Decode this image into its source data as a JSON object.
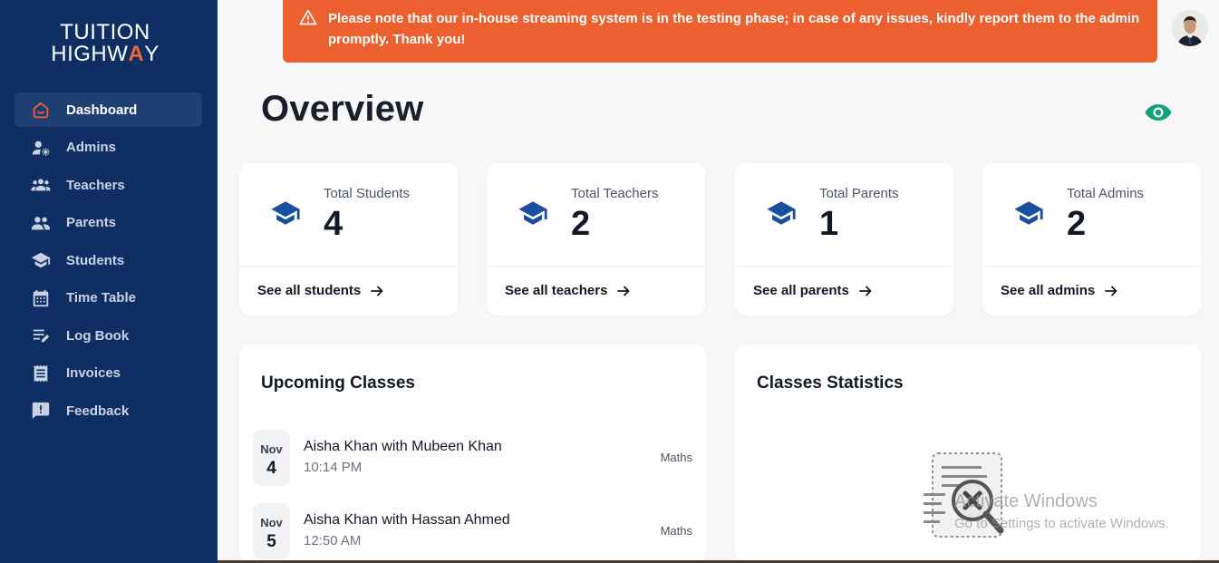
{
  "brand": {
    "line1": "TUITION",
    "line2_pre": "HIGHW",
    "line2_accent": "A",
    "line2_post": "Y"
  },
  "sidebar": {
    "items": [
      {
        "label": "Dashboard",
        "icon": "home-icon",
        "active": true
      },
      {
        "label": "Admins",
        "icon": "admin-icon"
      },
      {
        "label": "Teachers",
        "icon": "group-icon"
      },
      {
        "label": "Parents",
        "icon": "people-icon"
      },
      {
        "label": "Students",
        "icon": "graduation-cap-icon"
      },
      {
        "label": "Time Table",
        "icon": "calendar-icon"
      },
      {
        "label": "Log Book",
        "icon": "edit-list-icon"
      },
      {
        "label": "Invoices",
        "icon": "invoice-icon"
      },
      {
        "label": "Feedback",
        "icon": "feedback-icon"
      }
    ]
  },
  "banner": {
    "message": "Please note that our in-house streaming system is in the testing phase; in case of any issues, kindly report them to the admin promptly. Thank you!"
  },
  "page": {
    "title": "Overview"
  },
  "stats": [
    {
      "label": "Total Students",
      "value": "4",
      "link": "See all students"
    },
    {
      "label": "Total Teachers",
      "value": "2",
      "link": "See all teachers"
    },
    {
      "label": "Total Parents",
      "value": "1",
      "link": "See all parents"
    },
    {
      "label": "Total Admins",
      "value": "2",
      "link": "See all admins"
    }
  ],
  "upcoming": {
    "title": "Upcoming Classes",
    "classes": [
      {
        "month": "Nov",
        "day": "4",
        "name": "Aisha Khan with Mubeen Khan",
        "time": "10:14 PM",
        "subject": "Maths"
      },
      {
        "month": "Nov",
        "day": "5",
        "name": "Aisha Khan with Hassan Ahmed",
        "time": "12:50 AM",
        "subject": "Maths"
      }
    ]
  },
  "statistics": {
    "title": "Classes Statistics"
  },
  "watermark": {
    "line1": "Activate Windows",
    "line2": "Go to Settings to activate Windows."
  },
  "colors": {
    "sidebar": "#0f2f64",
    "banner": "#ec5f2e",
    "accent_blue": "#1a4fa0",
    "eye_green": "#13a37a"
  }
}
